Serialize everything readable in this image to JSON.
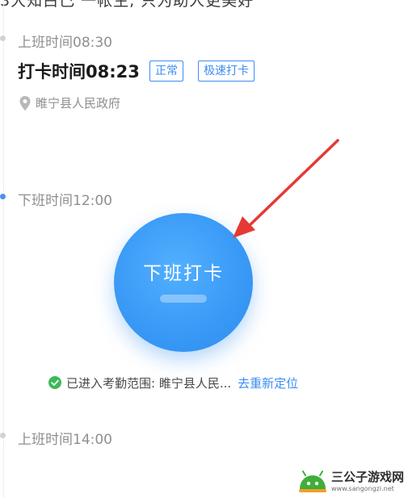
{
  "cut_text": "3大知白己 一帐生, 只为助人更美好",
  "shifts": [
    {
      "label": "上班时间08:30"
    },
    {
      "label": "下班时间12:00"
    },
    {
      "label": "上班时间14:00"
    }
  ],
  "morning": {
    "punch_time": "打卡时间08:23",
    "tags": [
      "正常",
      "极速打卡"
    ],
    "location": "睢宁县人民政府"
  },
  "punch_button": {
    "label": "下班打卡",
    "color": "#3a9af6"
  },
  "status": {
    "text": "已进入考勤范围: 睢宁县人民...",
    "relocate": "去重新定位"
  },
  "watermark": {
    "title": "三公子游戏网",
    "url": "www.sangongzi.net"
  },
  "icons": [
    "location-pin-icon",
    "check-circle-icon",
    "red-arrow-annotation",
    "sangongzi-logo-icon"
  ],
  "colors": {
    "accent": "#3d8df2",
    "annotation": "#e53935",
    "ok": "#3dba57"
  }
}
